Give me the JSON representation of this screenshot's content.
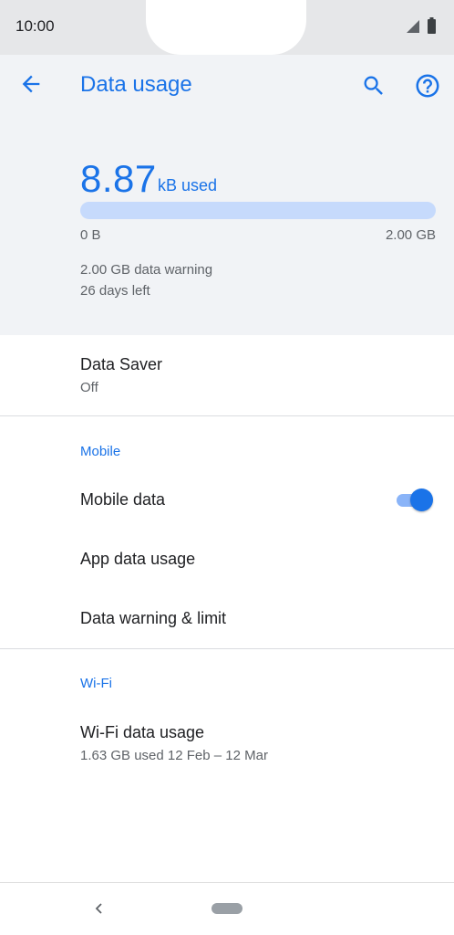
{
  "status_bar": {
    "time": "10:00"
  },
  "header": {
    "title": "Data usage",
    "usage_value": "8.87",
    "usage_unit": "kB used",
    "usage_fraction": 4.4e-06,
    "range_min": "0 B",
    "range_max": "2.00 GB",
    "warning": "2.00 GB data warning",
    "days_left": "26 days left"
  },
  "data_saver": {
    "title": "Data Saver",
    "subtitle": "Off"
  },
  "mobile": {
    "section": "Mobile",
    "mobile_data": "Mobile data",
    "mobile_data_on": true,
    "app_data_usage": "App data usage",
    "warning_limit": "Data warning & limit"
  },
  "wifi": {
    "section": "Wi-Fi",
    "title": "Wi-Fi data usage",
    "subtitle": "1.63 GB used 12 Feb – 12 Mar"
  },
  "icons": {
    "back": "arrow-left-icon",
    "search": "search-icon",
    "help": "help-circle-icon",
    "signal": "signal-icon",
    "battery": "battery-icon"
  },
  "colors": {
    "accent": "#1a73e8",
    "header_bg": "#f1f3f6",
    "statusbar_bg": "#e6e7e9"
  }
}
